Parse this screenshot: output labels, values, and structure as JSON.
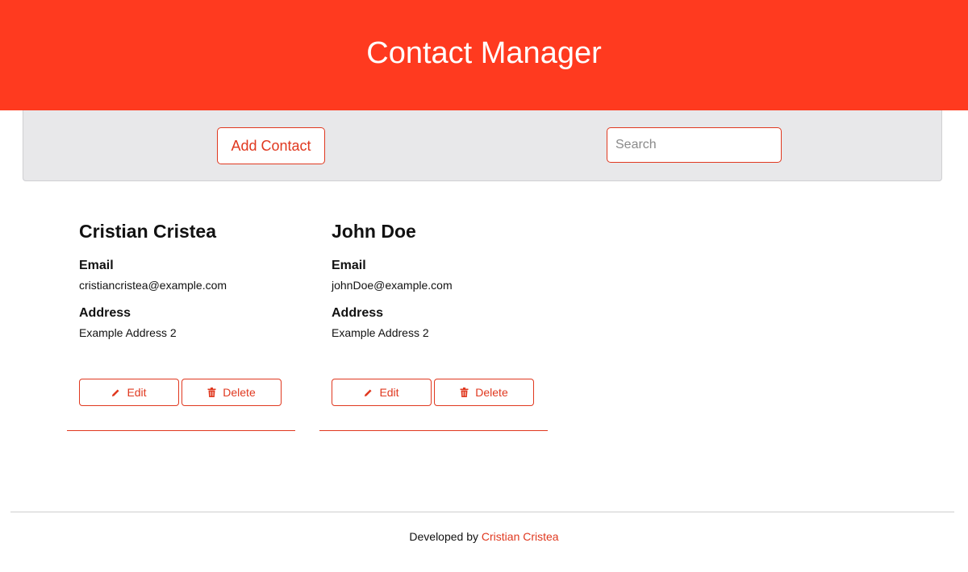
{
  "header": {
    "title": "Contact Manager"
  },
  "toolbar": {
    "add_label": "Add Contact",
    "search_placeholder": "Search",
    "search_value": ""
  },
  "contacts": [
    {
      "name": "Cristian Cristea",
      "email_label": "Email",
      "email": "cristiancristea@example.com",
      "address_label": "Address",
      "address": "Example Address 2",
      "edit_label": "Edit",
      "delete_label": "Delete"
    },
    {
      "name": "John Doe",
      "email_label": "Email",
      "email": "johnDoe@example.com",
      "address_label": "Address",
      "address": "Example Address 2",
      "edit_label": "Edit",
      "delete_label": "Delete"
    }
  ],
  "footer": {
    "prefix": "Developed by",
    "author": "Cristian Cristea"
  },
  "icons": {
    "edit": "pencil-icon",
    "delete": "trash-icon"
  },
  "colors": {
    "accent": "#ff3a1f",
    "accent_text": "#e0381f",
    "toolbar_bg": "#e8e8ea"
  }
}
